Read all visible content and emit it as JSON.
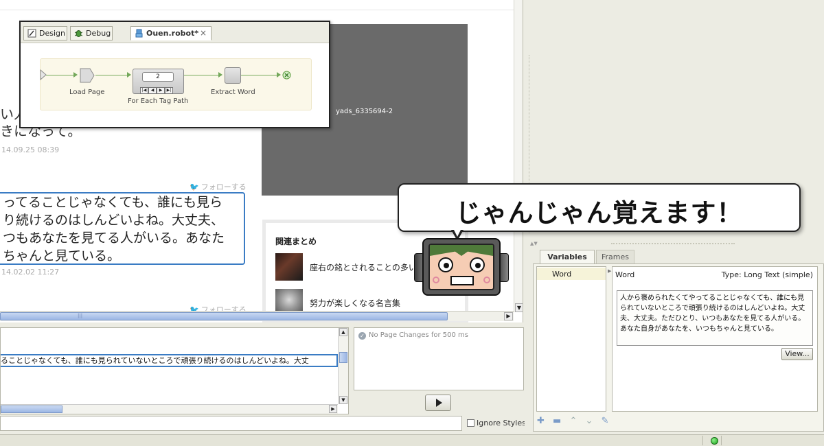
{
  "web": {
    "frag1": "い人",
    "frag2": "きになって。",
    "ts1": "14.09.25 08:39",
    "follow_label": "フォローする",
    "tweet_lines": [
      "ってることじゃなくても、誰にも見ら",
      "り続けるのはしんどいよね。大丈夫、",
      "つもあなたを見てる人がいる。あなた",
      "ちゃんと見ている。"
    ],
    "ts2": "14.02.02 11:27",
    "ad_label": "yads_6335694-2",
    "matome_title": "関連まとめ",
    "matome_items": [
      "座右の銘とされることの多い",
      "努力が楽しくなる名言集"
    ]
  },
  "designer": {
    "tab_design": "Design",
    "tab_debug": "Debug",
    "tab_file": "Ouen.robot*",
    "close_glyph": "×",
    "node1": "Load Page",
    "node2": "For Each Tag Path",
    "node2_counter": "2",
    "node3": "Extract Word"
  },
  "htmlpane": {
    "selected_text": "ることじゃなくても、誰にも見られていないところで頑張り続けるのはしんどいよね。大丈"
  },
  "changes": {
    "message": "No Page Changes for 500 ms"
  },
  "bottom": {
    "ignore_styles": "Ignore Styles"
  },
  "panel": {
    "tab_variables": "Variables",
    "tab_frames": "Frames",
    "var_name": "Word",
    "detail_name": "Word",
    "detail_type": "Type: Long Text (simple)",
    "detail_value": "人から褒められたくてやってることじゃなくても、誰にも見られていないところで頑張り続けるのはしんどいよね。大丈夫、大丈夫。ただひとり、いつもあなたを見てる人がいる。あなた自身があなたを、いつもちゃんと見ている。",
    "view_button": "View...",
    "tools": [
      "✚",
      "▬",
      "⌃",
      "⌄",
      "✎"
    ]
  },
  "callout": {
    "text": "じゃんじゃん覚えます！"
  },
  "colors": {
    "accent_blue": "#3a7cc4",
    "flow_green": "#73a85a",
    "mascot_hair": "#4f7a3a"
  }
}
